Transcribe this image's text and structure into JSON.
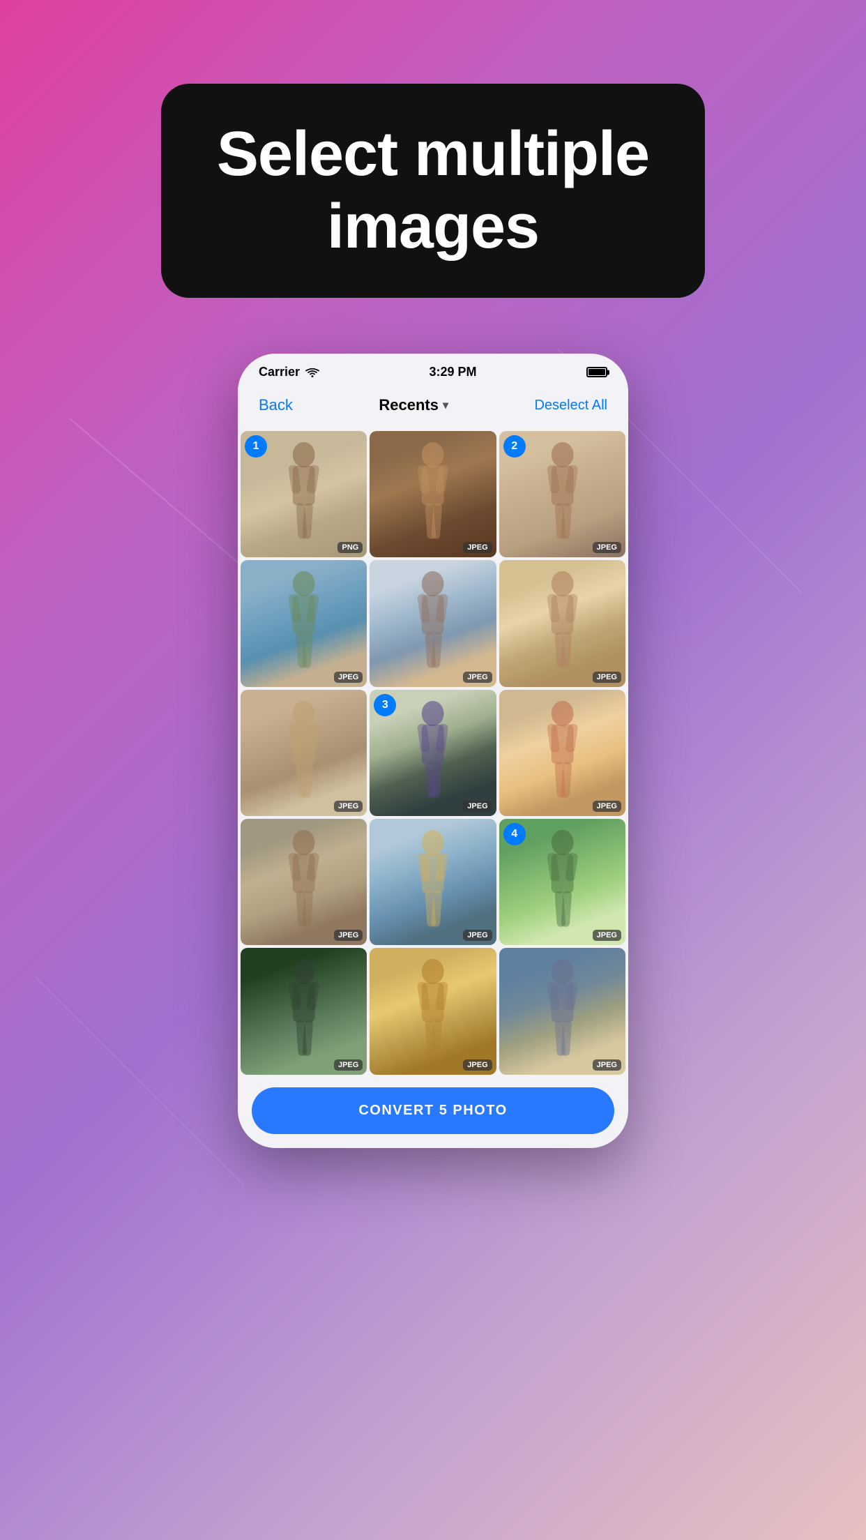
{
  "background": {
    "gradient_start": "#e040a0",
    "gradient_end": "#c0d8f0"
  },
  "header": {
    "title_line1": "Select multiple",
    "title_line2": "images"
  },
  "status_bar": {
    "carrier": "Carrier",
    "time": "3:29 PM"
  },
  "nav": {
    "back_label": "Back",
    "title": "Recents",
    "deselect_label": "Deselect All"
  },
  "photos": [
    {
      "id": 1,
      "format": "PNG",
      "selection": 1,
      "bg_class": "photo-1-bg"
    },
    {
      "id": 2,
      "format": "JPEG",
      "selection": null,
      "bg_class": "photo-2-bg"
    },
    {
      "id": 3,
      "format": "JPEG",
      "selection": 2,
      "bg_class": "photo-3-bg"
    },
    {
      "id": 4,
      "format": "JPEG",
      "selection": null,
      "bg_class": "photo-4-bg"
    },
    {
      "id": 5,
      "format": "JPEG",
      "selection": null,
      "bg_class": "photo-5-bg"
    },
    {
      "id": 6,
      "format": "JPEG",
      "selection": null,
      "bg_class": "photo-6-bg"
    },
    {
      "id": 7,
      "format": "JPEG",
      "selection": null,
      "bg_class": "photo-7-bg"
    },
    {
      "id": 8,
      "format": "JPEG",
      "selection": 3,
      "bg_class": "photo-8-bg"
    },
    {
      "id": 9,
      "format": "JPEG",
      "selection": null,
      "bg_class": "photo-9-bg"
    },
    {
      "id": 10,
      "format": "JPEG",
      "selection": null,
      "bg_class": "photo-10-bg"
    },
    {
      "id": 11,
      "format": "JPEG",
      "selection": null,
      "bg_class": "photo-11-bg"
    },
    {
      "id": 12,
      "format": "JPEG",
      "selection": 4,
      "bg_class": "photo-12-bg"
    },
    {
      "id": 13,
      "format": "JPEG",
      "selection": null,
      "bg_class": "photo-13-bg"
    },
    {
      "id": 14,
      "format": "JPEG",
      "selection": null,
      "bg_class": "photo-14-bg"
    },
    {
      "id": 15,
      "format": "JPEG",
      "selection": null,
      "bg_class": "photo-15-bg"
    }
  ],
  "convert_button": {
    "label": "CONVERT 5 PHOTO"
  }
}
